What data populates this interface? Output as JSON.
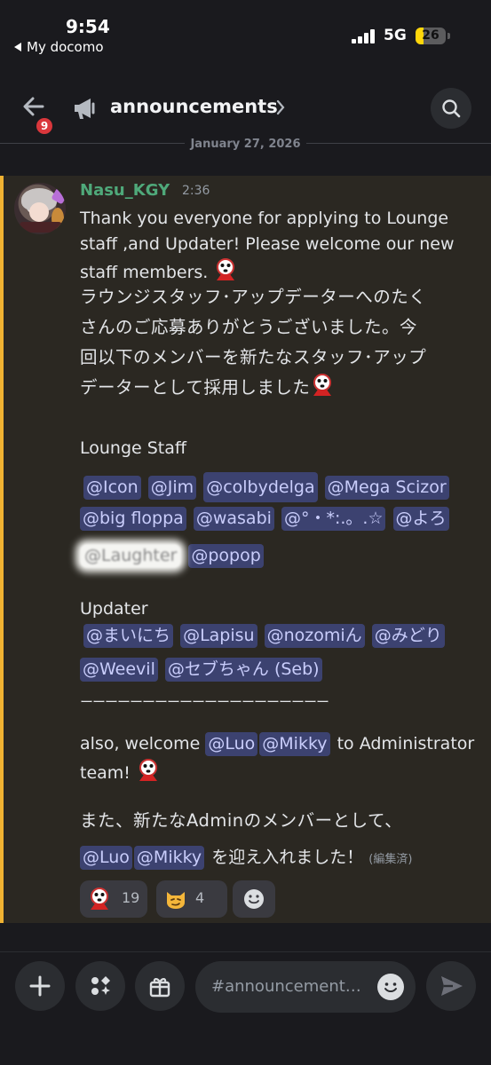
{
  "status": {
    "time": "9:54",
    "carrier": "My docomo",
    "network": "5G",
    "battery": "26",
    "battery_level": 0.26
  },
  "header": {
    "back_badge": "9",
    "channel": "announcements"
  },
  "date_divider": "January 27, 2026",
  "message": {
    "author": "Nasu_KGY",
    "time": "2:36",
    "en_line1": "Thank you everyone for applying to Lounge",
    "en_line2": "staff ,and Updater! Please welcome our new",
    "en_line3": "staff members.",
    "jp_line1": "ラウンジスタッフ･アップデーターへのたく",
    "jp_line2": "さんのご応募ありがとうございました。今",
    "jp_line3": "回以下のメンバーを新たなスタッフ･アップ",
    "jp_line4": "データーとして採用しました",
    "lounge_heading": "Lounge Staff",
    "lounge_mentions_row1": [
      "@Icon",
      "@Jim",
      "@colbydelga",
      "@Mega Scizor"
    ],
    "lounge_mentions_row2": [
      "@big floppa",
      "@wasabi",
      "@°・*:.。.☆",
      "@よろ"
    ],
    "lounge_mentions_row3": [
      "@Laughter",
      "@popop"
    ],
    "updater_heading": "Updater",
    "updater_mentions_row1": [
      "@まいにち",
      "@Lapisu",
      "@nozomiん",
      "@みどり"
    ],
    "updater_mentions_row2": [
      "@Weevil",
      "@セブちゃん (Seb)"
    ],
    "separator": "ーーーーーーーーーーーーーーーーーーーー",
    "admin_en_prefix": "also, welcome",
    "admin_mentions": [
      "@Luo",
      "@Mikky"
    ],
    "admin_en_suffix": "to Administrator",
    "admin_en_line2": "team!",
    "admin_jp_line1": "また、新たなAdminのメンバーとして、",
    "admin_jp_suffix": "を迎え入れました！",
    "edited": "(編集済)"
  },
  "reactions": [
    {
      "emoji": "shy-guy-emoji",
      "count": "19"
    },
    {
      "emoji": "smirk-cat-emoji",
      "count": "4"
    }
  ],
  "composer": {
    "placeholder": "#announcement…"
  }
}
